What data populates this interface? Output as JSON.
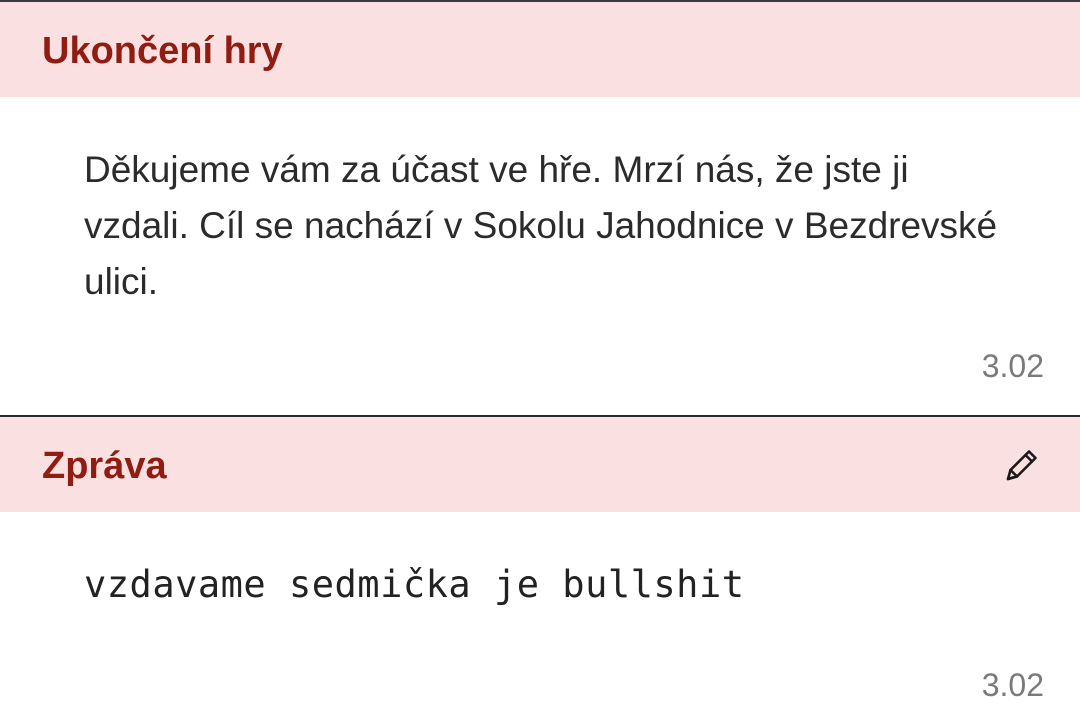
{
  "messages": [
    {
      "title": "Ukončení hry",
      "body": "Děkujeme vám za účast ve hře. Mrzí nás, že jste ji vzdali. Cíl se nachází v Sokolu Jahodnice v Bezdrevské ulici.",
      "time": "3.02"
    },
    {
      "title": "Zpráva",
      "body": "vzdavame sedmička je bullshit",
      "time": "3.02",
      "icon": "pencil-icon"
    }
  ],
  "colors": {
    "header_bg": "#fbe0e2",
    "title": "#8f1d12",
    "body_text": "#2b2b2b",
    "timestamp": "#7a7a7a"
  }
}
